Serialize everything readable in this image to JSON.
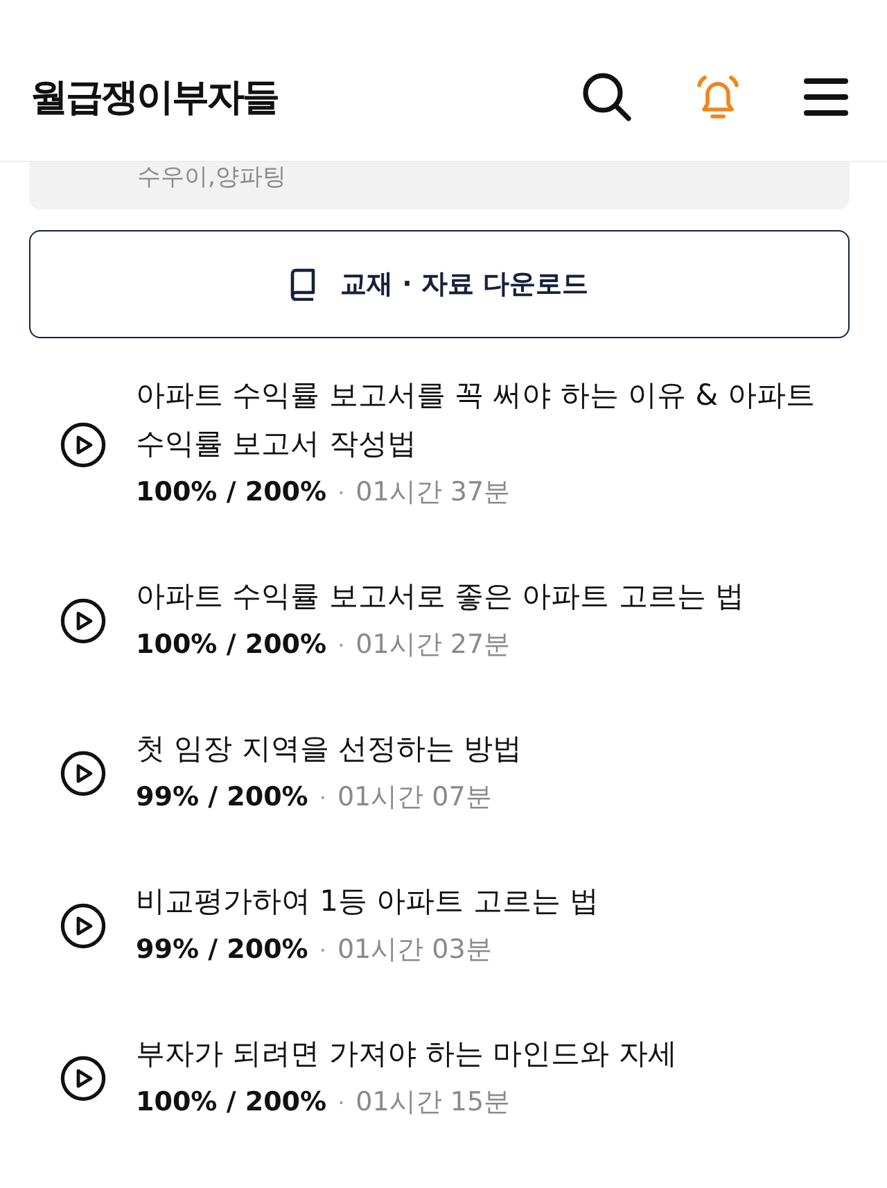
{
  "header": {
    "logo": "월급쟁이부자들"
  },
  "course_card": {
    "text": "수우이,양파팅"
  },
  "download_button": {
    "label": "교재 · 자료 다운로드"
  },
  "lessons": [
    {
      "title": "아파트 수익률 보고서를 꼭 써야 하는 이유 & 아파트 수익률 보고서 작성법",
      "progress": "100% / 200%",
      "separator": "·",
      "duration": "01시간 37분"
    },
    {
      "title": "아파트 수익률 보고서로 좋은 아파트 고르는 법",
      "progress": "100% / 200%",
      "separator": "·",
      "duration": "01시간 27분"
    },
    {
      "title": "첫 임장 지역을 선정하는 방법",
      "progress": "99% / 200%",
      "separator": "·",
      "duration": "01시간 07분"
    },
    {
      "title": "비교평가하여 1등 아파트 고르는 법",
      "progress": "99% / 200%",
      "separator": "·",
      "duration": "01시간 03분"
    },
    {
      "title": "부자가 되려면 가져야 하는 마인드와 자세",
      "progress": "100% / 200%",
      "separator": "·",
      "duration": "01시간 15분"
    }
  ]
}
